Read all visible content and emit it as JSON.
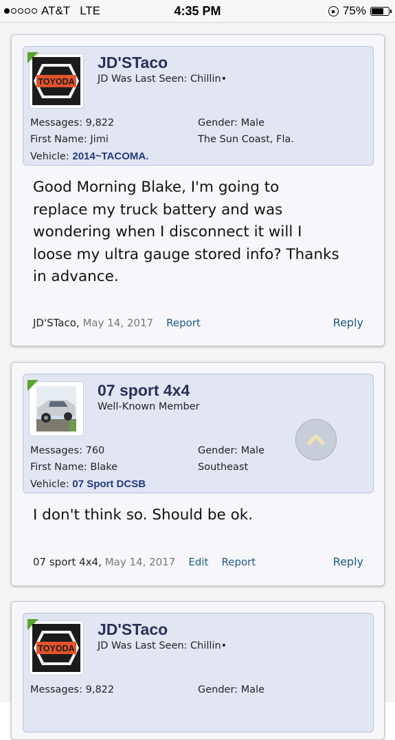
{
  "status_bar": {
    "carrier": "AT&T",
    "network": "LTE",
    "time": "4:35 PM",
    "battery": "75%",
    "battery_level": 0.75,
    "signal_bars": 1,
    "icons": [
      "signal-dots-icon",
      "rotation-lock-icon",
      "battery-icon"
    ]
  },
  "posts": [
    {
      "username": "JD'STaco",
      "user_title": "JD Was Last Seen: Chillin•",
      "avatar": "toyoda-logo",
      "messages_label": "Messages:",
      "messages_value": "9,822",
      "first_name_label": "First Name:",
      "first_name_value": "Jimi",
      "vehicle_label": "Vehicle:",
      "vehicle_value": "2014~TACOMA.",
      "gender_label": "Gender:",
      "gender_value": "Male",
      "location": "The Sun Coast, Fla.",
      "message_lines": [
        "Good Morning Blake, I'm going to",
        "replace my truck battery and was",
        "wondering when I disconnect it will I",
        "loose my ultra gauge stored info? Thanks",
        "in advance."
      ],
      "footer_author": "JD'STaco,",
      "footer_date": "May 14, 2017",
      "report_label": "Report",
      "reply_label": "Reply"
    },
    {
      "username": "07 sport 4x4",
      "user_title": "Well-Known Member",
      "avatar": "truck-photo",
      "messages_label": "Messages:",
      "messages_value": "760",
      "first_name_label": "First Name:",
      "first_name_value": "Blake",
      "vehicle_label": "Vehicle:",
      "vehicle_value": "07 Sport DCSB",
      "gender_label": "Gender:",
      "gender_value": "Male",
      "location": "Southeast",
      "message_lines": [
        "I don't think so. Should be ok."
      ],
      "footer_author": "07 sport 4x4,",
      "footer_date": "May 14, 2017",
      "edit_label": "Edit",
      "report_label": "Report",
      "reply_label": "Reply"
    },
    {
      "username": "JD'STaco",
      "user_title": "JD Was Last Seen: Chillin•",
      "avatar": "toyoda-logo",
      "messages_label": "Messages:",
      "messages_value": "9,822",
      "gender_label": "Gender:",
      "gender_value": "Male"
    }
  ],
  "toyoda_logo_text": "TOYODA",
  "colors": {
    "username": "#2a2f5a",
    "vehicle": "#203a7a",
    "link": "#1e5a83",
    "userbox_bg": "#e2e6f3",
    "online_flag": "#5aa52e"
  }
}
